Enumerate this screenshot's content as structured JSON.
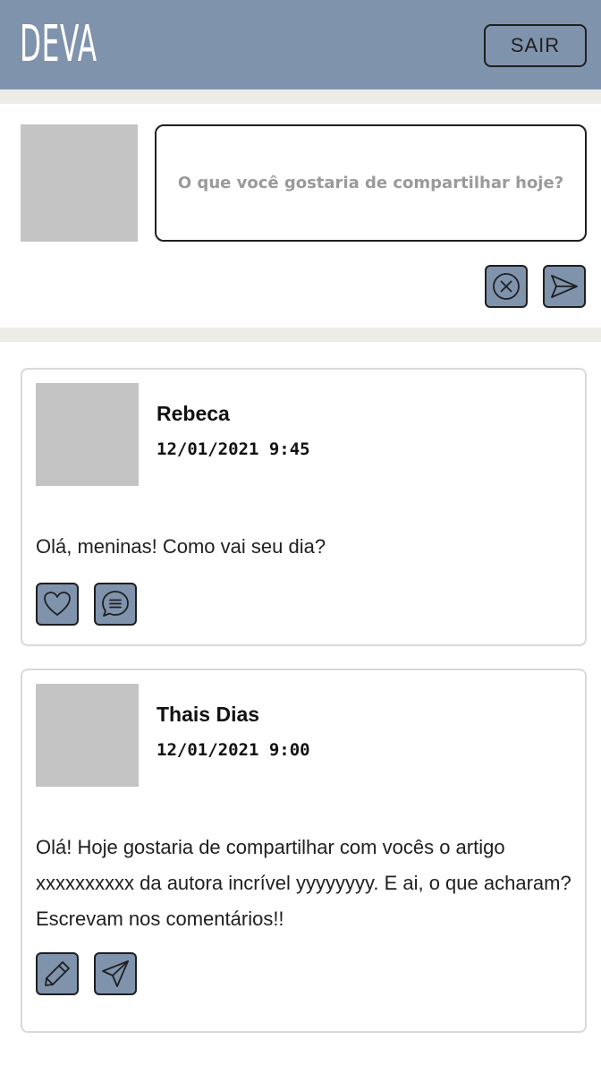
{
  "header": {
    "logo": "DEVA",
    "logout_label": "SAIR",
    "accent_color": "#8093ad"
  },
  "composer": {
    "placeholder": "O que você gostaria de compartilhar hoje?",
    "cancel_icon": "close-circle-icon",
    "send_icon": "send-icon"
  },
  "posts": [
    {
      "author": "Rebeca",
      "timestamp": "12/01/2021 9:45",
      "text": "Olá, meninas! Como vai seu dia?",
      "actions": [
        "heart-icon",
        "comment-icon"
      ]
    },
    {
      "author": "Thais Dias",
      "timestamp": "12/01/2021 9:00",
      "text": "Olá! Hoje gostaria de compartilhar com vocês o artigo xxxxxxxxxx da autora incrível yyyyyyyy. E ai, o que acharam? Escrevam nos comentários!!",
      "actions": [
        "pencil-icon",
        "share-icon"
      ]
    }
  ]
}
